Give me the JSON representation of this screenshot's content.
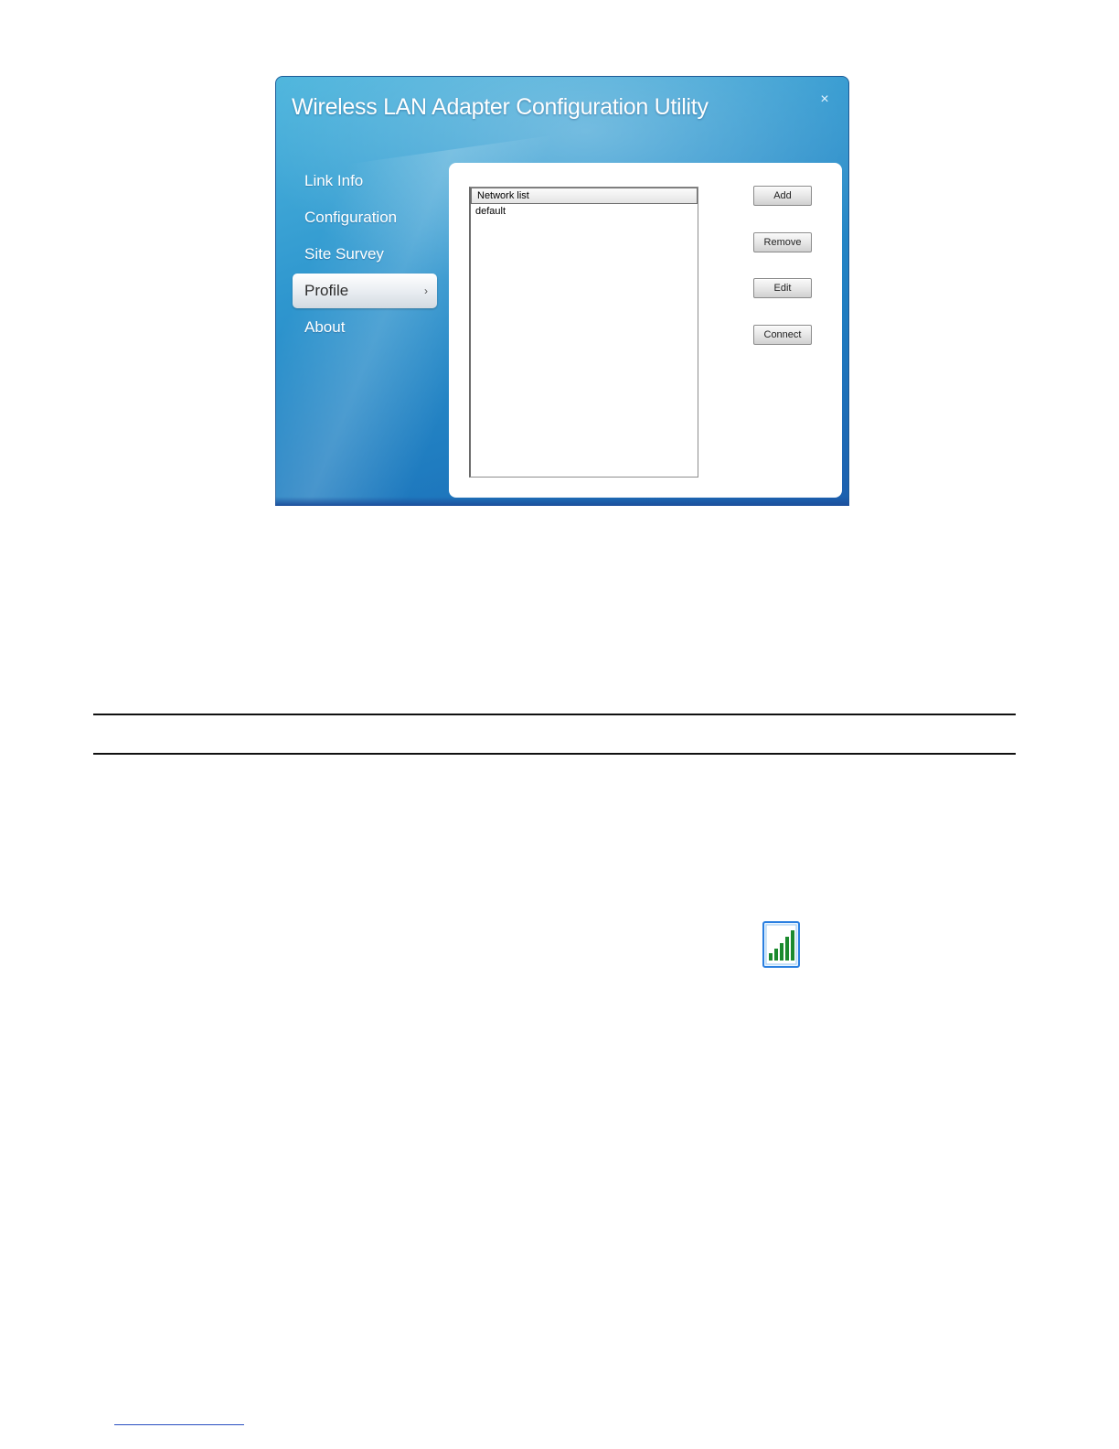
{
  "window": {
    "title": "Wireless LAN Adapter Configuration Utility",
    "close_glyph": "×"
  },
  "nav": {
    "items": [
      {
        "label": "Link Info",
        "active": false
      },
      {
        "label": "Configuration",
        "active": false
      },
      {
        "label": "Site Survey",
        "active": false
      },
      {
        "label": "Profile",
        "active": true
      },
      {
        "label": "About",
        "active": false
      }
    ],
    "active_arrow": "›"
  },
  "profile": {
    "list_header": "Network list",
    "rows": [
      "default"
    ],
    "buttons": {
      "add": "Add",
      "remove": "Remove",
      "edit": "Edit",
      "connect": "Connect"
    }
  },
  "icons": {
    "signal_strength": "signal-strength-icon",
    "signal_bars": 5,
    "accent_color": "#1b8a2e",
    "frame_color": "#2a7fe0"
  }
}
